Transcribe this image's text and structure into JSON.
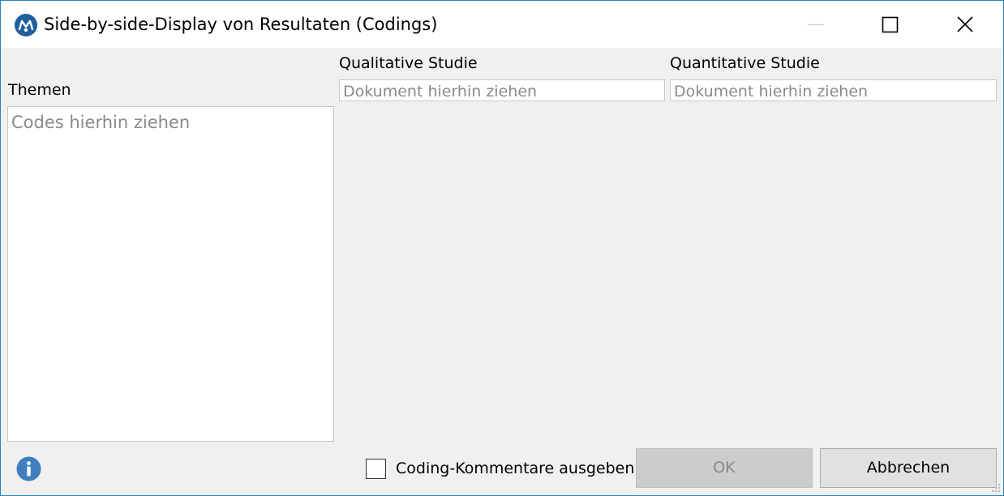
{
  "window": {
    "title": "Side-by-side-Display von Resultaten (Codings)",
    "app_icon": "maxqda-logo-icon",
    "controls": [
      "minimize-icon",
      "maximize-icon",
      "close-icon"
    ]
  },
  "themes": {
    "label": "Themen",
    "placeholder": "Codes hierhin ziehen"
  },
  "documents": [
    {
      "label": "Qualitative Studie",
      "placeholder": "Dokument hierhin ziehen"
    },
    {
      "label": "Quantitative Studie",
      "placeholder": "Dokument hierhin ziehen"
    }
  ],
  "footer": {
    "info_icon": "info-icon",
    "checkbox_label": "Coding-Kommentare ausgeben",
    "checkbox_checked": false,
    "ok_label": "OK",
    "ok_enabled": false,
    "cancel_label": "Abbrechen"
  },
  "colors": {
    "accent": "#2a80c6",
    "icon_blue": "#1f5f9e",
    "dialog_bg": "#f0f0f0",
    "placeholder": "#8a8a8a"
  }
}
